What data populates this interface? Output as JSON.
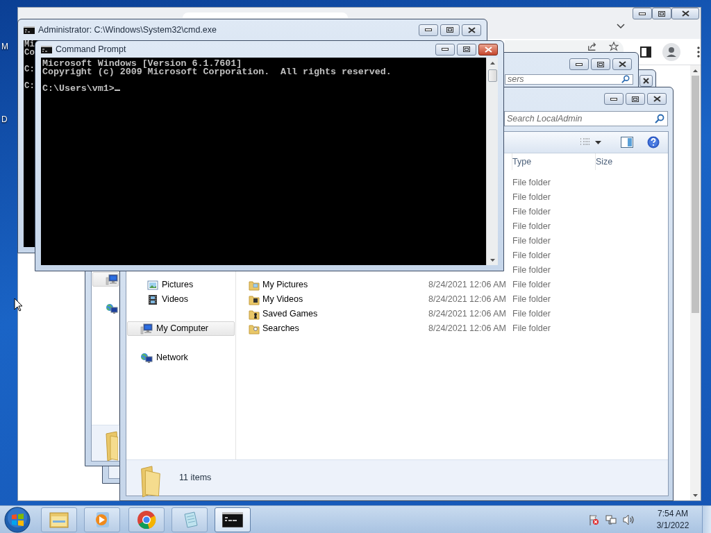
{
  "desktop": {
    "icon_labels": [
      "M",
      "D"
    ]
  },
  "back_explorer": {
    "search": {
      "placeholder": "sers"
    },
    "nav": [
      {
        "kind": "computer",
        "selected": true
      },
      {
        "kind": "network",
        "selected": false
      }
    ]
  },
  "admin_console": {
    "title": "Administrator: C:\\Windows\\System32\\cmd.exe",
    "output": "Mi\nCo\n\nC:\n\nC:"
  },
  "explorer": {
    "search": {
      "placeholder": "Search LocalAdmin"
    },
    "columns": [
      "Type",
      "Size"
    ],
    "nav": [
      {
        "label": "Pictures",
        "kind": "pictures",
        "selected": false
      },
      {
        "label": "Videos",
        "kind": "videos",
        "selected": false
      },
      {
        "label": "My Computer",
        "kind": "computer",
        "selected": true
      },
      {
        "label": "Network",
        "kind": "network",
        "selected": false
      }
    ],
    "rows": [
      {
        "type": "File folder"
      },
      {
        "type": "File folder"
      },
      {
        "type": "File folder"
      },
      {
        "type": "File folder"
      },
      {
        "type": "File folder"
      },
      {
        "type": "File folder"
      },
      {
        "type": "File folder"
      },
      {
        "kind": "pictures",
        "name": "My Pictures",
        "date_modified": "8/24/2021 12:06 AM",
        "type": "File folder"
      },
      {
        "kind": "videos",
        "name": "My Videos",
        "date_modified": "8/24/2021 12:06 AM",
        "type": "File folder"
      },
      {
        "kind": "games",
        "name": "Saved Games",
        "date_modified": "8/24/2021 12:06 AM",
        "type": "File folder"
      },
      {
        "kind": "searches",
        "name": "Searches",
        "date_modified": "8/24/2021 12:06 AM",
        "type": "File folder"
      }
    ],
    "status": "11 items"
  },
  "command_prompt": {
    "title": "Command Prompt",
    "output": "Microsoft Windows [Version 6.1.7601]\nCopyright (c) 2009 Microsoft Corporation.  All rights reserved.\n\nC:\\Users\\vm1>"
  },
  "taskbar": {
    "buttons": [
      {
        "kind": "explorer",
        "selected": false
      },
      {
        "kind": "media",
        "selected": false
      },
      {
        "kind": "chrome",
        "selected": false
      },
      {
        "kind": "notepad",
        "selected": false
      },
      {
        "kind": "console",
        "selected": true
      }
    ],
    "time": "7:54 AM",
    "date": "3/1/2022"
  }
}
